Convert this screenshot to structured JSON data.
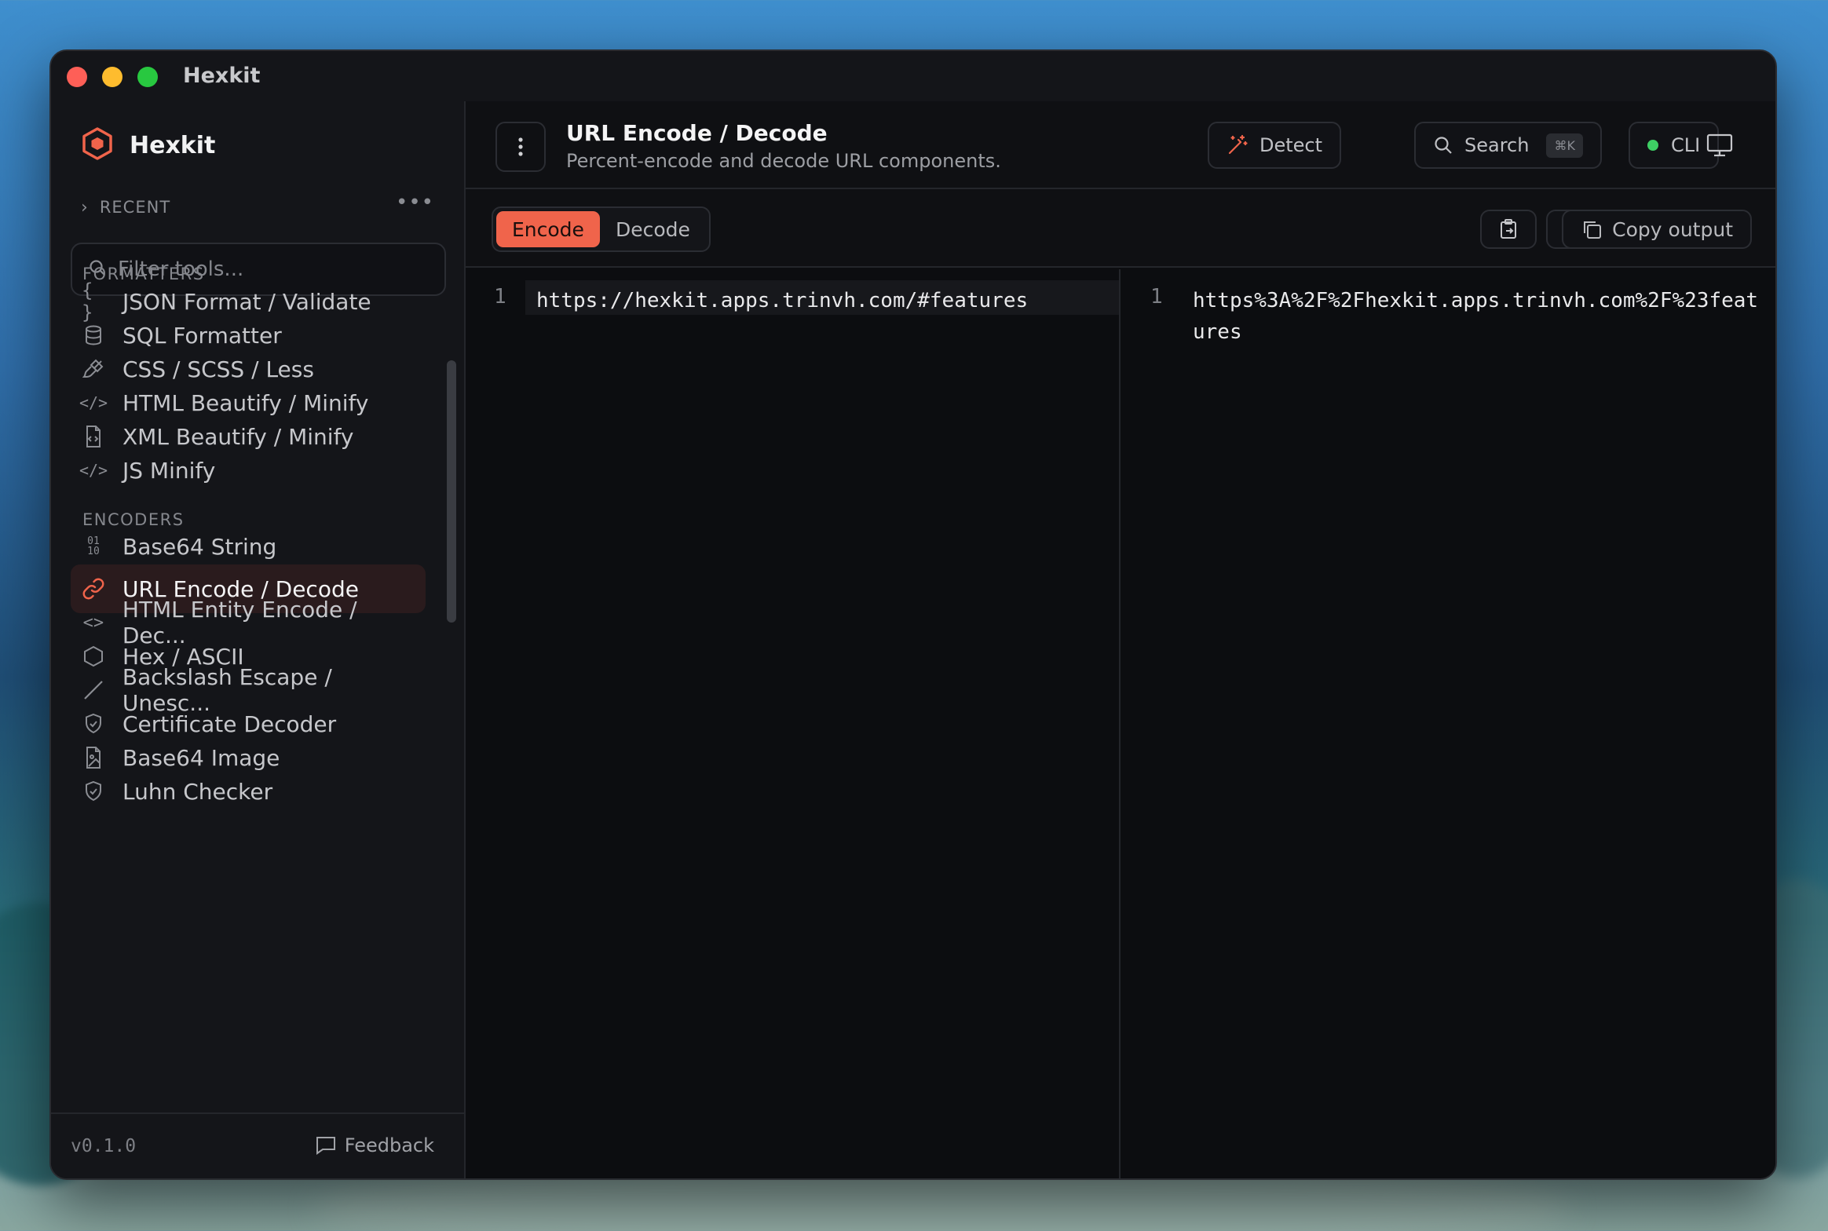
{
  "window": {
    "title": "Hexkit"
  },
  "sidebar": {
    "brand": "Hexkit",
    "recent_label": "RECENT",
    "filter_placeholder": "Filter tools...",
    "sections": {
      "formatters": "FORMATTERS",
      "encoders": "ENCODERS"
    },
    "formatters": [
      {
        "label": "JSON Format / Validate",
        "icon": "braces-icon"
      },
      {
        "label": "SQL Formatter",
        "icon": "database-icon"
      },
      {
        "label": "CSS / SCSS / Less",
        "icon": "paintbrush-icon"
      },
      {
        "label": "HTML Beautify / Minify",
        "icon": "code-icon"
      },
      {
        "label": "XML Beautify / Minify",
        "icon": "file-code-icon"
      },
      {
        "label": "JS Minify",
        "icon": "code-icon"
      }
    ],
    "encoders": [
      {
        "label": "Base64 String",
        "icon": "binary-icon"
      },
      {
        "label": "URL Encode / Decode",
        "icon": "link-icon",
        "active": true
      },
      {
        "label": "HTML Entity Encode / Dec...",
        "icon": "chevrons-code-icon"
      },
      {
        "label": "Hex / ASCII",
        "icon": "hexagon-icon"
      },
      {
        "label": "Backslash Escape / Unesc...",
        "icon": "slash-icon"
      },
      {
        "label": "Certificate Decoder",
        "icon": "shield-check-icon"
      },
      {
        "label": "Base64 Image",
        "icon": "file-image-icon"
      },
      {
        "label": "Luhn Checker",
        "icon": "shield-check-icon"
      }
    ],
    "version": "v0.1.0",
    "feedback_label": "Feedback"
  },
  "header": {
    "title": "URL Encode / Decode",
    "subtitle": "Percent-encode and decode URL components.",
    "detect_label": "Detect",
    "search_label": "Search",
    "search_shortcut": "⌘K",
    "cli_label": "CLI",
    "cli_status_color": "#3ecf64"
  },
  "toolbar": {
    "modes": [
      "Encode",
      "Decode"
    ],
    "active_mode": "Encode",
    "copy_output_label": "Copy output"
  },
  "editor": {
    "input_line_number": "1",
    "input": "https://hexkit.apps.trinvh.com/#features",
    "output_line_number": "1",
    "output": "https%3A%2F%2Fhexkit.apps.trinvh.com%2F%23features"
  },
  "colors": {
    "accent": "#f0644b",
    "background": "#0c0d10",
    "sidebar": "#141519"
  }
}
